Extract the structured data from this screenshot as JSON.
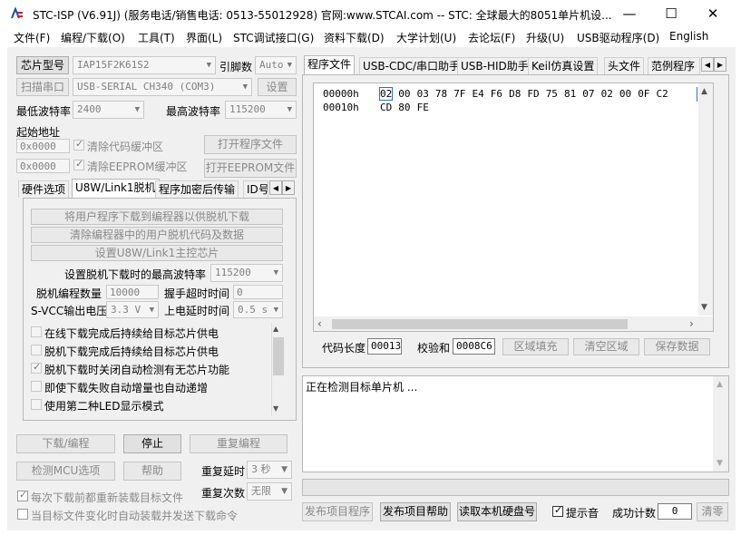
{
  "window": {
    "title": "STC-ISP (V6.91J) (服务电话/销售电话: 0513-55012928) 官网:www.STCAI.com  -- STC: 全球最大的8051单片机设...",
    "minimize_glyph": "—",
    "maximize_glyph": "☐",
    "close_glyph": "✕"
  },
  "menu": [
    "文件(F)",
    "编程/下载(O)",
    "工具(T)",
    "界面(L)",
    "STC调试接口(G)",
    "资料下载(D)",
    "大学计划(U)",
    "去论坛(F)",
    "升级(U)",
    "USB驱动程序(D)",
    "English"
  ],
  "left": {
    "chip_button": "芯片型号",
    "chip_value": "IAP15F2K61S2",
    "pin_label": "引脚数",
    "pin_value": "Auto",
    "scan_button": "扫描串口",
    "port_value": "USB-SERIAL CH340 (COM3)",
    "settings_button": "设置",
    "min_baud_label": "最低波特率",
    "min_baud_value": "2400",
    "max_baud_label": "最高波特率",
    "max_baud_value": "115200",
    "start_addr_label": "起始地址",
    "addr1": "0x0000",
    "addr2": "0x0000",
    "clear_code_label": "清除代码缓冲区",
    "clear_eeprom_label": "清除EEPROM缓冲区",
    "open_prog_button": "打开程序文件",
    "open_eeprom_button": "打开EEPROM文件",
    "tabs": [
      "硬件选项",
      "U8W/Link1脱机",
      "程序加密后传输",
      "ID号"
    ],
    "u8w": {
      "btn1": "将用户程序下载到编程器以供脱机下载",
      "btn2": "清除编程器中的用户脱机代码及数据",
      "btn3": "设置U8W/Link1主控芯片",
      "max_baud_label": "设置脱机下载时的最高波特率",
      "max_baud_value": "115200",
      "count_label": "脱机编程数量",
      "count_value": "10000",
      "timeout_label": "握手超时时间",
      "timeout_value": "0",
      "svcc_label": "S-VCC输出电压",
      "svcc_value": "3.3 V",
      "delay_label": "上电延时时间",
      "delay_value": "0.5 s",
      "options": [
        {
          "label": "在线下载完成后持续给目标芯片供电",
          "checked": false
        },
        {
          "label": "脱机下载完成后持续给目标芯片供电",
          "checked": false
        },
        {
          "label": "脱机下载时关闭自动检测有无芯片功能",
          "checked": true
        },
        {
          "label": "即使下载失败自动增量也自动递增",
          "checked": false
        },
        {
          "label": "使用第二种LED显示模式",
          "checked": false
        }
      ]
    },
    "download_button": "下载/编程",
    "stop_button": "停止",
    "reprogram_button": "重复编程",
    "check_mcu_button": "检测MCU选项",
    "help_button": "帮助",
    "repeat_delay_label": "重复延时",
    "repeat_delay_value": "3 秒",
    "repeat_count_label": "重复次数",
    "repeat_count_value": "无限",
    "reload_label": "每次下载前都重新装载目标文件",
    "auto_send_label": "当目标文件变化时自动装载并发送下载命令"
  },
  "right": {
    "tabs": [
      "程序文件",
      "USB-CDC/串口助手",
      "USB-HID助手",
      "Keil仿真设置",
      "头文件",
      "范例程序"
    ],
    "hex_rows": [
      {
        "addr": "00000h",
        "bytes": [
          "02",
          "00",
          "03",
          "78",
          "7F",
          "E4",
          "F6",
          "D8",
          "FD",
          "75",
          "81",
          "07",
          "02",
          "00",
          "0F",
          "C2"
        ]
      },
      {
        "addr": "00010h",
        "bytes": [
          "CD",
          "80",
          "FE"
        ]
      }
    ],
    "code_len_label": "代码长度",
    "code_len_value": "00013",
    "checksum_label": "校验和",
    "checksum_value": "0008C6",
    "fill_button": "区域填充",
    "clear_button": "清空区域",
    "save_button": "保存数据",
    "status_text": "正在检测目标单片机 ...",
    "publish_prog_button": "发布项目程序",
    "publish_help_button": "发布项目帮助",
    "read_disk_button": "读取本机硬盘号",
    "sound_label": "提示音",
    "success_label": "成功计数",
    "success_value": "0",
    "reset_button": "清零"
  }
}
